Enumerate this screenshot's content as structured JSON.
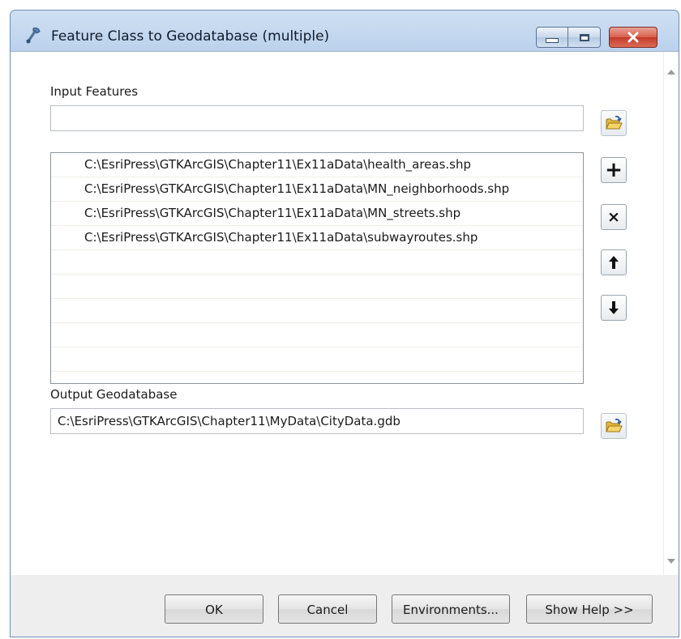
{
  "window": {
    "title": "Feature Class to Geodatabase (multiple)"
  },
  "input_features": {
    "label": "Input Features",
    "value": "",
    "items": [
      "C:\\EsriPress\\GTKArcGIS\\Chapter11\\Ex11aData\\health_areas.shp",
      "C:\\EsriPress\\GTKArcGIS\\Chapter11\\Ex11aData\\MN_neighborhoods.shp",
      "C:\\EsriPress\\GTKArcGIS\\Chapter11\\Ex11aData\\MN_streets.shp",
      "C:\\EsriPress\\GTKArcGIS\\Chapter11\\Ex11aData\\subwayroutes.shp"
    ]
  },
  "output_geodatabase": {
    "label": "Output Geodatabase",
    "value": "C:\\EsriPress\\GTKArcGIS\\Chapter11\\MyData\\CityData.gdb"
  },
  "list_buttons": {
    "add": "+",
    "remove": "×"
  },
  "buttons": {
    "ok": "OK",
    "cancel": "Cancel",
    "environments": "Environments...",
    "show_help": "Show Help >>"
  },
  "colors": {
    "title_bar": "#bcd2ec",
    "close_button": "#c3392a",
    "folder_icon": "#f2c84b"
  },
  "icons": {
    "app": "geoprocessing-tool-icon",
    "browse": "open-folder-icon",
    "add": "plus-icon",
    "remove": "x-icon",
    "up": "arrow-up-icon",
    "down": "arrow-down-icon"
  }
}
